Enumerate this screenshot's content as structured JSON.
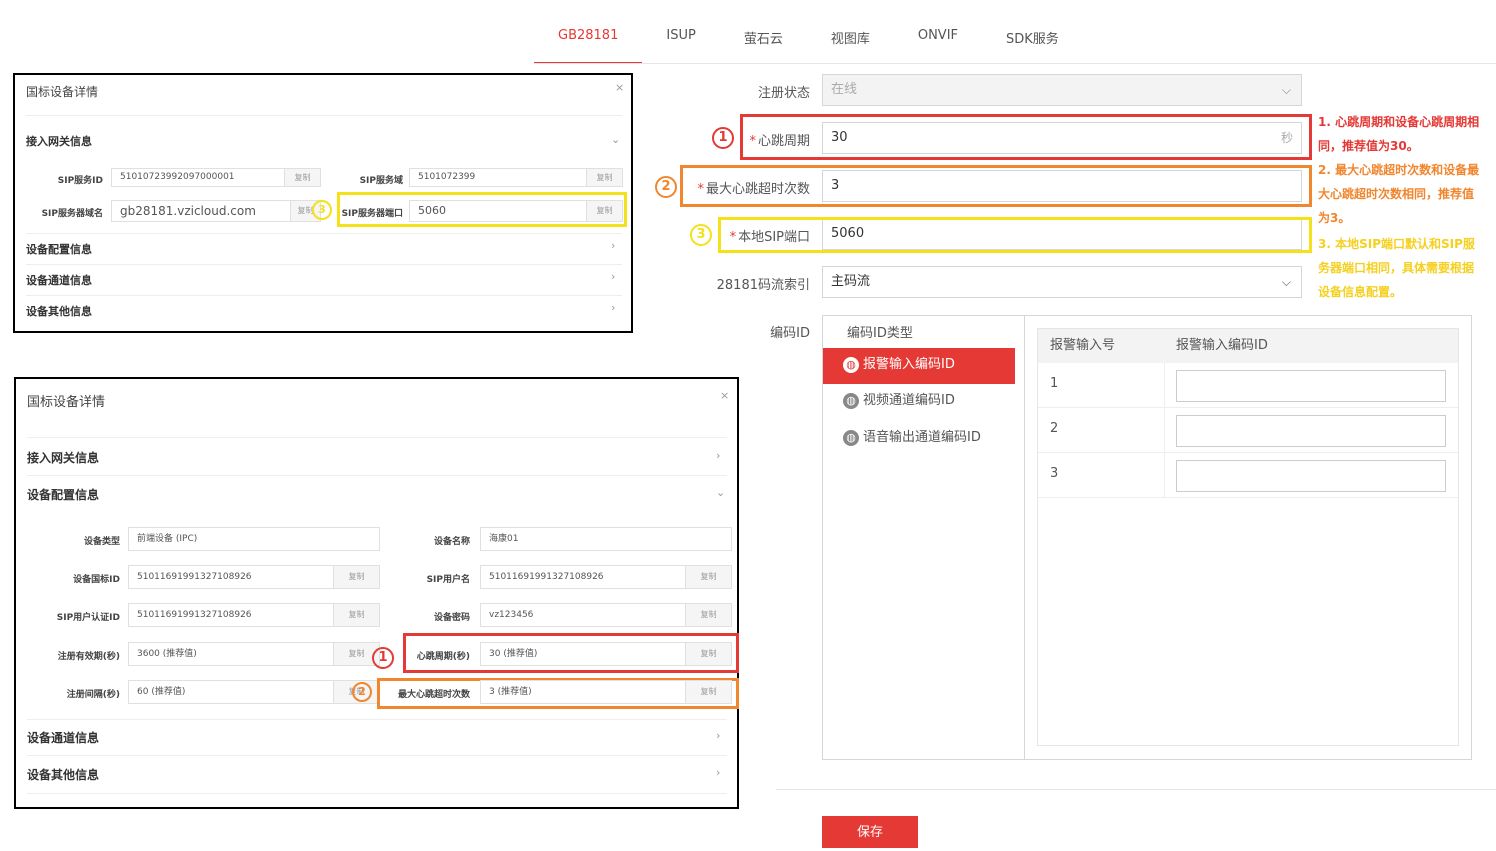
{
  "tabs": [
    "GB28181",
    "ISUP",
    "萤石云",
    "视图库",
    "ONVIF",
    "SDK服务"
  ],
  "form": {
    "reg_status_label": "注册状态",
    "reg_status_value": "在线",
    "heartbeat_label": "心跳周期",
    "heartbeat_value": "30",
    "heartbeat_unit": "秒",
    "max_timeout_label": "最大心跳超时次数",
    "max_timeout_value": "3",
    "local_sip_label": "本地SIP端口",
    "local_sip_value": "5060",
    "stream_index_label": "28181码流索引",
    "stream_index_value": "主码流",
    "encode_id_label": "编码ID",
    "required_mark": "*"
  },
  "encode": {
    "type_header": "编码ID类型",
    "types": [
      "报警输入编码ID",
      "视频通道编码ID",
      "语音输出通道编码ID"
    ],
    "table_headers": [
      "报警输入号",
      "报警输入编码ID"
    ],
    "rows": [
      "1",
      "2",
      "3"
    ]
  },
  "save_label": "保存",
  "notes": {
    "n1": [
      "1. 心跳周期和设备心跳周期相",
      "同，推荐值为30。"
    ],
    "n2": [
      "2. 最大心跳超时次数和设备最",
      "大心跳超时次数相同，推荐值",
      "为3。"
    ],
    "n3": [
      "3. 本地SIP端口默认和SIP服",
      "务器端口相同，具体需要根据",
      "设备信息配置。"
    ]
  },
  "markers": {
    "one": "①",
    "two": "②",
    "three": "③"
  },
  "panel_top": {
    "title": "国标设备详情",
    "close": "×",
    "section_gateway": "接入网关信息",
    "fields": {
      "sip_server_id_label": "SIP服务ID",
      "sip_server_id_value": "51010723992097000001",
      "sip_domain_label": "SIP服务域",
      "sip_domain_value": "5101072399",
      "sip_host_label": "SIP服务器域名",
      "sip_host_value": "gb28181.vzicloud.com",
      "sip_port_label": "SIP服务器端口",
      "sip_port_value": "5060",
      "copy": "复制"
    },
    "section_config": "设备配置信息",
    "section_channel": "设备通道信息",
    "section_other": "设备其他信息"
  },
  "panel_bottom": {
    "title": "国标设备详情",
    "close": "×",
    "section_gateway": "接入网关信息",
    "section_config": "设备配置信息",
    "fields": {
      "dev_type_label": "设备类型",
      "dev_type_value": "前端设备 (IPC)",
      "dev_name_label": "设备名称",
      "dev_name_value": "海康01",
      "gb_id_label": "设备国标ID",
      "gb_id_value": "51011691991327108926",
      "sip_user_label": "SIP用户名",
      "sip_user_value": "51011691991327108926",
      "sip_auth_label": "SIP用户认证ID",
      "sip_auth_value": "51011691991327108926",
      "dev_pwd_label": "设备密码",
      "dev_pwd_value": "vz123456",
      "reg_valid_label": "注册有效期(秒)",
      "reg_valid_value": "3600 (推荐值)",
      "heartbeat_label": "心跳周期(秒)",
      "heartbeat_value": "30 (推荐值)",
      "reg_interval_label": "注册间隔(秒)",
      "reg_interval_value": "60 (推荐值)",
      "max_timeout_label": "最大心跳超时次数",
      "max_timeout_value": "3 (推荐值)",
      "copy": "复制"
    },
    "section_channel": "设备通道信息",
    "section_other": "设备其他信息"
  },
  "colors": {
    "red": "#e53935",
    "orange": "#f0862e",
    "yellow": "#f5e11a",
    "note_red": "#e53935",
    "note_orange": "#f0862e",
    "note_yellow": "#f5d020"
  }
}
